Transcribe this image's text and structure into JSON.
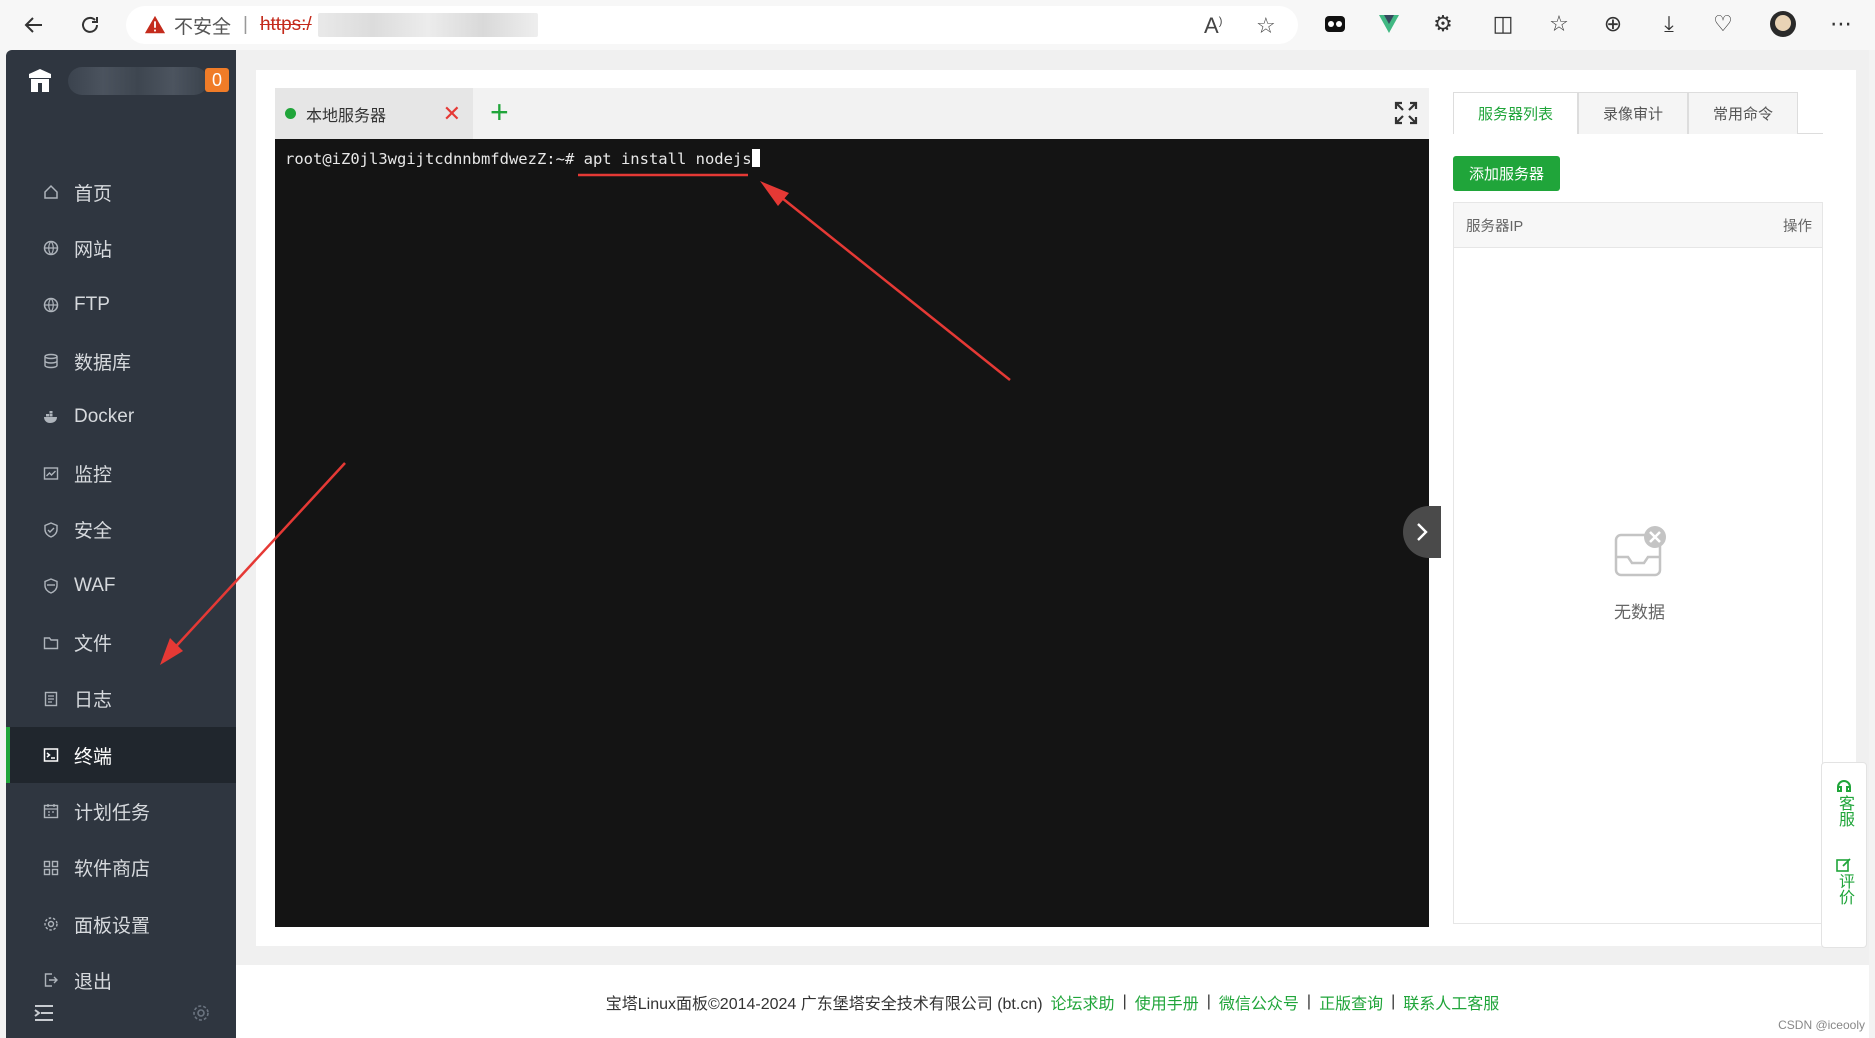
{
  "browser": {
    "security_label": "不安全",
    "separator": "|",
    "url_prefix": "https:/"
  },
  "sidebar": {
    "badge_count": "0",
    "items": [
      {
        "label": "首页",
        "icon": "home-icon"
      },
      {
        "label": "网站",
        "icon": "globe-icon"
      },
      {
        "label": "FTP",
        "icon": "globe-icon"
      },
      {
        "label": "数据库",
        "icon": "database-icon"
      },
      {
        "label": "Docker",
        "icon": "docker-icon"
      },
      {
        "label": "监控",
        "icon": "monitor-icon"
      },
      {
        "label": "安全",
        "icon": "shield-check-icon"
      },
      {
        "label": "WAF",
        "icon": "shield-icon"
      },
      {
        "label": "文件",
        "icon": "folder-icon"
      },
      {
        "label": "日志",
        "icon": "log-icon"
      },
      {
        "label": "终端",
        "icon": "terminal-icon",
        "active": true
      },
      {
        "label": "计划任务",
        "icon": "calendar-icon"
      },
      {
        "label": "软件商店",
        "icon": "apps-icon"
      },
      {
        "label": "面板设置",
        "icon": "gear-icon"
      },
      {
        "label": "退出",
        "icon": "logout-icon"
      }
    ]
  },
  "terminal": {
    "tab_label": "本地服务器",
    "prompt": "root@iZ0jl3wgijtcdnnbmfdwezZ:~# ",
    "command": "apt install nodejs"
  },
  "right_panel": {
    "tabs": [
      "服务器列表",
      "录像审计",
      "常用命令"
    ],
    "active_tab": 0,
    "add_button": "添加服务器",
    "col_ip": "服务器IP",
    "col_action": "操作",
    "empty_text": "无数据"
  },
  "footer": {
    "copyright": "宝塔Linux面板©2014-2024 广东堡塔安全技术有限公司 (bt.cn)",
    "links": [
      "论坛求助",
      "使用手册",
      "微信公众号",
      "正版查询",
      "联系人工客服"
    ],
    "separator": "|"
  },
  "float_widget": {
    "service": "客服",
    "review": "评价"
  },
  "watermark": "CSDN @iceooly",
  "colors": {
    "accent": "#20a53a",
    "sidebar_bg": "#2f3640",
    "terminal_bg": "#141414",
    "badge": "#f07c28",
    "annotation": "#e53935"
  }
}
